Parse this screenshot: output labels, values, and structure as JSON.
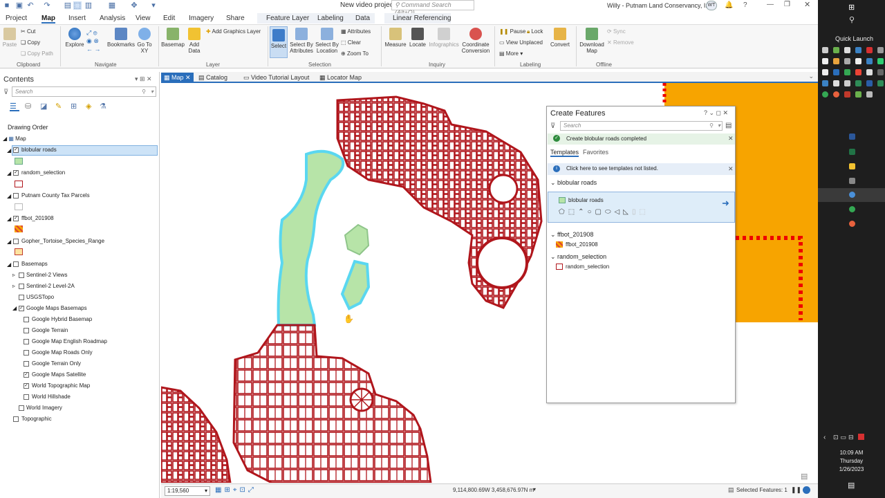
{
  "window": {
    "title": "New video project",
    "user": "Willy - Putnam Land Conservancy, Inc.",
    "user_initials": "WT",
    "command_search_placeholder": "Command Search (Alt+Q)"
  },
  "tabs": [
    "Project",
    "Map",
    "Insert",
    "Analysis",
    "View",
    "Edit",
    "Imagery",
    "Share",
    "Feature Layer",
    "Labeling",
    "Data",
    "Linear Referencing"
  ],
  "ribbon": {
    "clipboard": {
      "group": "Clipboard",
      "paste": "Paste",
      "cut": "Cut",
      "copy": "Copy",
      "copy_path": "Copy Path"
    },
    "navigate": {
      "group": "Navigate",
      "explore": "Explore",
      "bookmarks": "Bookmarks",
      "goto": "Go To XY"
    },
    "layer": {
      "group": "Layer",
      "basemap": "Basemap",
      "add_data": "Add Data",
      "add_graphics": "Add Graphics Layer"
    },
    "selection": {
      "group": "Selection",
      "select": "Select",
      "by_attr": "Select By Attributes",
      "by_loc": "Select By Location",
      "attributes": "Attributes",
      "clear": "Clear",
      "zoom_to": "Zoom To"
    },
    "inquiry": {
      "group": "Inquiry",
      "measure": "Measure",
      "locate": "Locate",
      "infographics": "Infographics",
      "coord": "Coordinate Conversion"
    },
    "labeling": {
      "group": "Labeling",
      "pause": "Pause",
      "lock": "Lock",
      "view_unplaced": "View Unplaced",
      "more": "More",
      "convert": "Convert"
    },
    "offline": {
      "group": "Offline",
      "download": "Download Map",
      "sync": "Sync",
      "remove": "Remove"
    }
  },
  "contents": {
    "title": "Contents",
    "search_placeholder": "Search",
    "drawing_order": "Drawing Order",
    "map": "Map",
    "layers": [
      {
        "name": "blobular roads",
        "checked": true
      },
      {
        "name": "random_selection",
        "checked": true
      },
      {
        "name": "Putnam County Tax Parcels",
        "checked": false
      },
      {
        "name": "ffbot_201908",
        "checked": true
      },
      {
        "name": "Gopher_Tortoise_Species_Range",
        "checked": false
      },
      {
        "name": "Basemaps",
        "checked": false
      }
    ],
    "basemaps": [
      "Sentinel-2 Views",
      "Sentinel-2 Level-2A",
      "USGSTopo",
      "Google Maps Basemaps"
    ],
    "google": [
      {
        "name": "Google Hybrid Basemap",
        "checked": false
      },
      {
        "name": "Google Terrain",
        "checked": false
      },
      {
        "name": "Google Map English Roadmap",
        "checked": false
      },
      {
        "name": "Google Map Roads Only",
        "checked": false
      },
      {
        "name": "Google Terrain Only",
        "checked": false
      },
      {
        "name": "Google Maps Satellite",
        "checked": true
      },
      {
        "name": "World Topographic Map",
        "checked": true
      },
      {
        "name": "World Hillshade",
        "checked": false
      }
    ],
    "world_imagery": "World Imagery",
    "topographic": "Topographic"
  },
  "map_tabs": [
    "Map",
    "Catalog",
    "Video Tutorial Layout",
    "Locator Map"
  ],
  "create_features": {
    "title": "Create Features",
    "search_placeholder": "Search",
    "status": "Create blobular roads completed",
    "tab_templates": "Templates",
    "tab_favorites": "Favorites",
    "info": "Click here to see templates not listed.",
    "groups": [
      {
        "name": "blobular roads",
        "template": "blobular roads"
      },
      {
        "name": "ffbot_201908",
        "template": "ffbot_201908"
      },
      {
        "name": "random_selection",
        "template": "random_selection"
      }
    ]
  },
  "status": {
    "scale": "1:19,560",
    "coords": "9,114,800.69W 3,458,676.97N m",
    "selected": "Selected Features: 1"
  },
  "taskbar": {
    "quick_launch": "Quick Launch",
    "time": "10:09 AM",
    "day": "Thursday",
    "date": "1/26/2023"
  },
  "colors": {
    "accent": "#2a6ebb",
    "parcel": "#b0161c",
    "blob_fill": "#b7e4a8",
    "blob_stroke": "#5ad7f0",
    "orange": "#f7a400"
  }
}
